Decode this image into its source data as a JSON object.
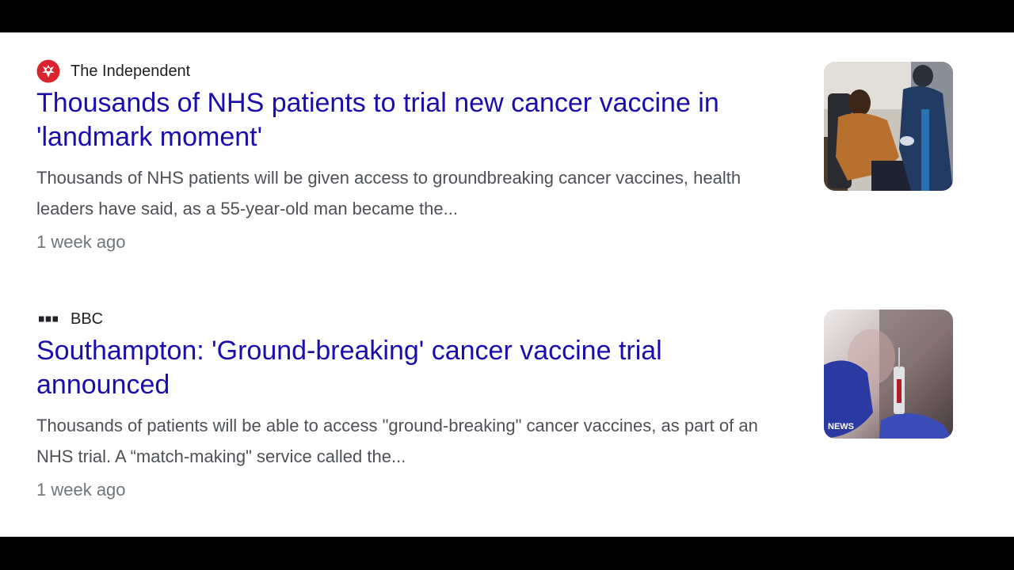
{
  "results": [
    {
      "source": "The Independent",
      "source_icon": "independent-eagle-icon",
      "title": "Thousands of NHS patients to trial new cancer vaccine in 'landmark moment'",
      "snippet": "Thousands of NHS patients will be given access to groundbreaking cancer vaccines, health leaders have said, as a 55-year-old man became the...",
      "time": "1 week ago",
      "thumbnail": "patient-receiving-vaccine-photo"
    },
    {
      "source": "BBC",
      "source_icon": "bbc-logo-icon",
      "title": "Southampton: 'Ground-breaking' cancer vaccine trial announced",
      "snippet": "Thousands of patients will be able to access \"ground-breaking\" cancer vaccines, as part of an NHS trial. A “match-making\" service called the...",
      "time": "1 week ago",
      "thumbnail": "syringe-gloved-hands-photo",
      "thumbnail_watermark": "NEWS"
    }
  ],
  "colors": {
    "title_link": "#1a0dab",
    "snippet_text": "#4d5156",
    "time_text": "#70757a",
    "independent_red": "#d9232e"
  }
}
